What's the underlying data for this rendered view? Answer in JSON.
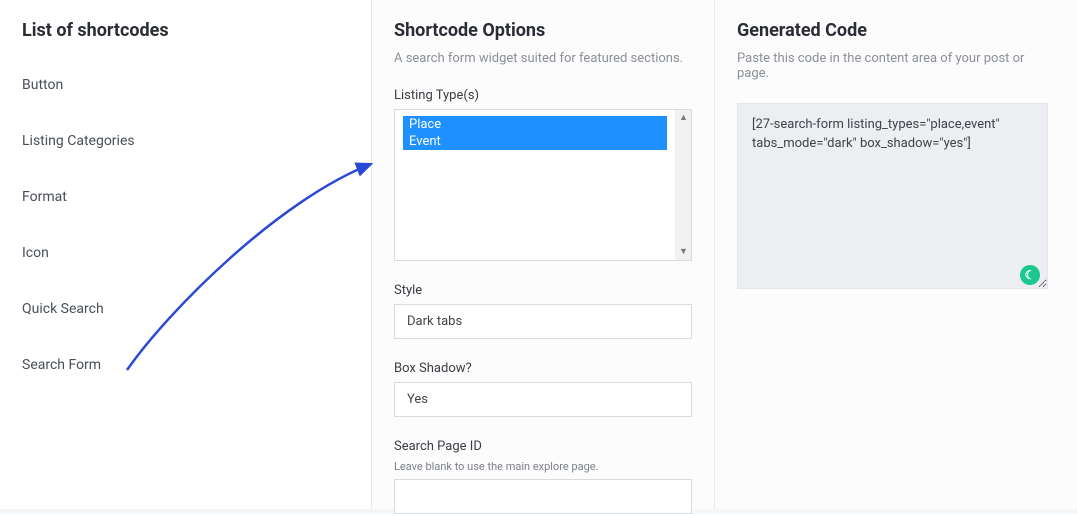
{
  "left": {
    "heading": "List of shortcodes",
    "items": [
      "Button",
      "Listing Categories",
      "Format",
      "Icon",
      "Quick Search",
      "Search Form"
    ]
  },
  "mid": {
    "heading": "Shortcode Options",
    "subtitle": "A search form widget suited for featured sections.",
    "listing_types_label": "Listing Type(s)",
    "listing_types_options": [
      "Place",
      "Event"
    ],
    "style_label": "Style",
    "style_value": "Dark tabs",
    "box_shadow_label": "Box Shadow?",
    "box_shadow_value": "Yes",
    "search_page_id_label": "Search Page ID",
    "search_page_id_note": "Leave blank to use the main explore page.",
    "search_page_id_value": ""
  },
  "right": {
    "heading": "Generated Code",
    "subtitle": "Paste this code in the content area of your post or page.",
    "code": "[27-search-form listing_types=\"place,event\" tabs_mode=\"dark\" box_shadow=\"yes\"]"
  }
}
